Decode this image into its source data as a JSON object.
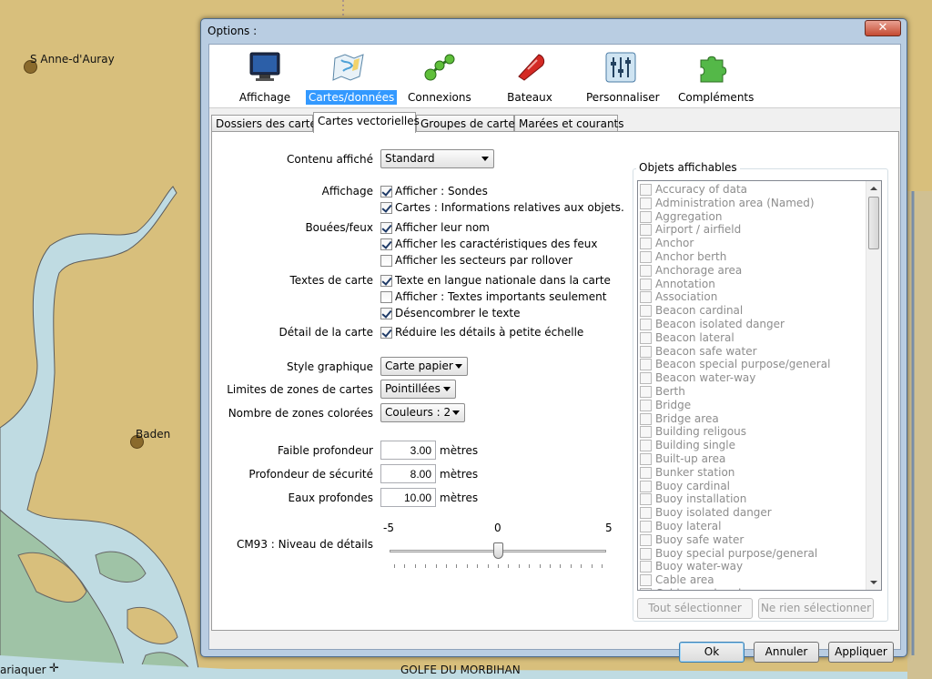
{
  "map": {
    "labels": {
      "anne": "S Anne-d'Auray",
      "baden": "Baden",
      "locmariaquer": "ariaquer",
      "golfe": "GOLFE DU MORBIHAN"
    }
  },
  "dialog": {
    "title": "Options :",
    "close_glyph": "✕",
    "toolbar": [
      {
        "label": "Affichage",
        "icon": "monitor-icon"
      },
      {
        "label": "Cartes/données",
        "icon": "chart-map-icon"
      },
      {
        "label": "Connexions",
        "icon": "connections-icon"
      },
      {
        "label": "Bateaux",
        "icon": "boat-icon"
      },
      {
        "label": "Personnaliser",
        "icon": "sliders-icon"
      },
      {
        "label": "Compléments",
        "icon": "puzzle-icon"
      }
    ],
    "tabs": [
      "Dossiers des cartes",
      "Cartes vectorielles",
      "Groupes de cartes",
      "Marées et courants"
    ],
    "active_tab": "Cartes vectorielles",
    "form": {
      "contenu_label": "Contenu affiché",
      "contenu_value": "Standard",
      "affichage_label": "Affichage",
      "affichage_sondes": "Afficher : Sondes",
      "affichage_infos": "Cartes : Informations relatives aux objets.",
      "bouees_label": "Bouées/feux",
      "bouees_nom": "Afficher leur nom",
      "bouees_caract": "Afficher les caractéristiques des feux",
      "bouees_secteurs": "Afficher les secteurs par rollover",
      "textes_label": "Textes de carte",
      "textes_langue": "Texte en langue nationale dans la carte",
      "textes_importants": "Afficher : Textes importants seulement",
      "textes_desencombrer": "Désencombrer le texte",
      "detail_label": "Détail de la carte",
      "detail_reduire": "Réduire les détails à petite échelle",
      "style_label": "Style graphique",
      "style_value": "Carte papier",
      "limites_label": "Limites de zones de cartes",
      "limites_value": "Pointillées",
      "nombre_label": "Nombre de zones colorées",
      "nombre_value": "Couleurs : 2",
      "faible_label": "Faible profondeur",
      "faible_value": "3.00",
      "securite_label": "Profondeur de sécurité",
      "securite_value": "8.00",
      "eaux_label": "Eaux profondes",
      "eaux_value": "10.00",
      "unit": "mètres",
      "cm93_label": "CM93 : Niveau de détails",
      "slider_min": "-5",
      "slider_mid": "0",
      "slider_max": "5",
      "slider_value": 0
    },
    "checks": {
      "sondes": true,
      "infos": true,
      "nom": true,
      "caract": true,
      "secteurs": false,
      "langue": true,
      "importants": false,
      "desencombrer": true,
      "reduire": true
    },
    "objects": {
      "title": "Objets affichables",
      "items": [
        "Accuracy of data",
        "Administration area (Named)",
        "Aggregation",
        "Airport / airfield",
        "Anchor",
        "Anchor berth",
        "Anchorage area",
        "Annotation",
        "Association",
        "Beacon cardinal",
        "Beacon isolated danger",
        "Beacon lateral",
        "Beacon safe water",
        "Beacon special purpose/general",
        "Beacon water-way",
        "Berth",
        "Bridge",
        "Bridge area",
        "Building religous",
        "Building single",
        "Built-up area",
        "Bunker station",
        "Buoy cardinal",
        "Buoy installation",
        "Buoy isolated danger",
        "Buoy lateral",
        "Buoy safe water",
        "Buoy special purpose/general",
        "Buoy water-way",
        "Cable area",
        "Cable overhead"
      ],
      "select_all": "Tout sélectionner",
      "select_none": "Ne rien sélectionner"
    },
    "buttons": {
      "ok": "Ok",
      "cancel": "Annuler",
      "apply": "Appliquer"
    }
  }
}
